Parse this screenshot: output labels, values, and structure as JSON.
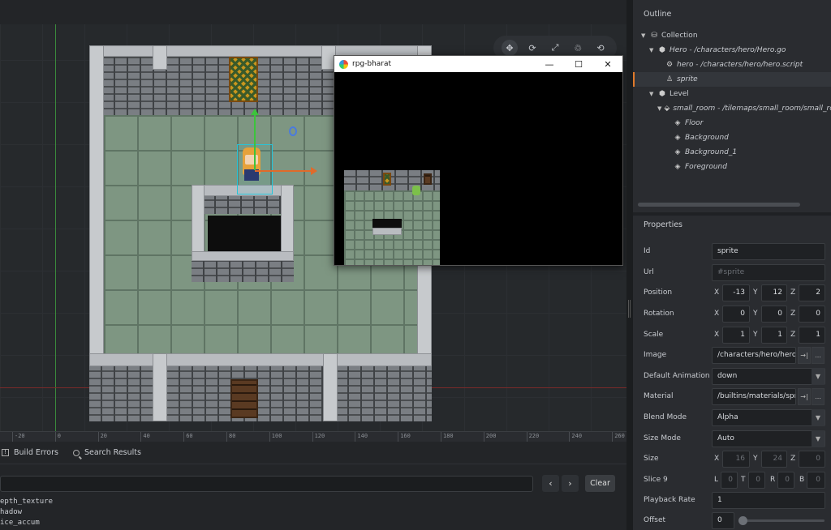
{
  "ruler": {
    "ticks": [
      "-20",
      "0",
      "20",
      "40",
      "60",
      "80",
      "100",
      "120",
      "140",
      "160",
      "180",
      "200",
      "220",
      "240",
      "260"
    ]
  },
  "toolbar": {
    "tools": [
      "move-tool-icon",
      "rotate-tool-icon",
      "scale-tool-icon",
      "erase-tool-icon",
      "camera-tool-icon"
    ]
  },
  "game_window": {
    "title": "rpg-bharat",
    "minimize": "—",
    "maximize": "☐",
    "close": "✕"
  },
  "bottom": {
    "tab_build_errors": "Build Errors",
    "tab_search_results": "Search Results",
    "prev": "‹",
    "next": "›",
    "clear": "Clear",
    "console_lines": [
      "epth_texture",
      "hadow",
      "ice_accum"
    ]
  },
  "outline": {
    "title": "Outline",
    "items": [
      {
        "label": "Collection",
        "italic": false
      },
      {
        "label": "Hero - /characters/hero/Hero.go",
        "italic": true
      },
      {
        "label": "hero - /characters/hero/hero.script",
        "italic": true
      },
      {
        "label": "sprite",
        "italic": true
      },
      {
        "label": "Level",
        "italic": false
      },
      {
        "label": "small_room - /tilemaps/small_room/small_room",
        "italic": true
      },
      {
        "label": "Floor",
        "italic": true
      },
      {
        "label": "Background",
        "italic": true
      },
      {
        "label": "Background_1",
        "italic": true
      },
      {
        "label": "Foreground",
        "italic": true
      }
    ]
  },
  "properties": {
    "title": "Properties",
    "id_label": "Id",
    "id_value": "sprite",
    "url_label": "Url",
    "url_value": "#sprite",
    "position_label": "Position",
    "position": {
      "x": "-13",
      "y": "12",
      "z": "2"
    },
    "rotation_label": "Rotation",
    "rotation": {
      "x": "0",
      "y": "0",
      "z": "0"
    },
    "scale_label": "Scale",
    "scale": {
      "x": "1",
      "y": "1",
      "z": "1"
    },
    "image_label": "Image",
    "image_value": "/characters/hero/hero.",
    "default_animation_label": "Default Animation",
    "default_animation_value": "down",
    "material_label": "Material",
    "material_value": "/builtins/materials/spri",
    "blend_mode_label": "Blend Mode",
    "blend_mode_value": "Alpha",
    "size_mode_label": "Size Mode",
    "size_mode_value": "Auto",
    "size_label": "Size",
    "size": {
      "x": "16",
      "y": "24",
      "z": "0"
    },
    "slice9_label": "Slice 9",
    "slice9": {
      "l": "0",
      "t": "0",
      "r": "0",
      "b": "0"
    },
    "playback_rate_label": "Playback Rate",
    "playback_rate_value": "1",
    "offset_label": "Offset",
    "offset_value": "0",
    "axis_x": "X",
    "axis_y": "Y",
    "axis_z": "Z",
    "axis_l": "L",
    "axis_t": "T",
    "axis_r": "R",
    "axis_b": "B",
    "ellipsis": "...",
    "goto": "→|"
  },
  "colors": {
    "accent": "#e07a2a",
    "selection_box": "#27c4d8",
    "gizmo_x": "#e06a2a",
    "gizmo_y": "#3cc43c"
  }
}
